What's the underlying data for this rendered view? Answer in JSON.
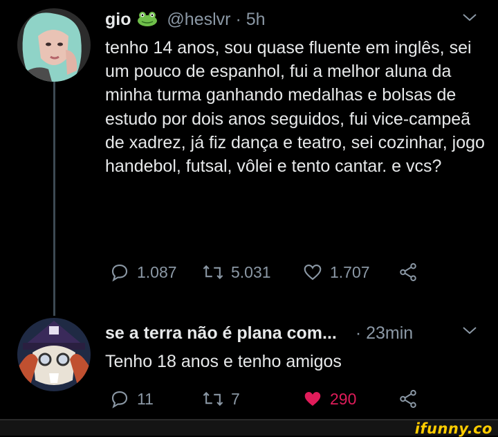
{
  "tweet1": {
    "display_name": "gio",
    "handle": "@heslvr",
    "separator": "·",
    "time": "5h",
    "text": "tenho 14 anos, sou quase fluente em inglês, sei um pouco de espanhol, fui a melhor aluna da minha turma ganhando medalhas e bolsas de estudo por dois anos seguidos, fui vice-campeã de xadrez, já fiz dança e teatro, sei cozinhar, jogo handebol, futsal, vôlei e tento cantar. e vcs?",
    "replies": "1.087",
    "retweets": "5.031",
    "likes": "1.707"
  },
  "tweet2": {
    "display_name": "se a terra não é plana com...",
    "separator": "·",
    "time": "23min",
    "text": "Tenho 18 anos e tenho amigos",
    "replies": "11",
    "retweets": "7",
    "likes": "290"
  },
  "watermark": "ifunny.co",
  "colors": {
    "background": "#000000",
    "muted": "#8b98a5",
    "like_active": "#e01c5a",
    "thread_line": "#3d4a53",
    "watermark": "#ffcc00"
  },
  "icons": [
    "frog-emoji-icon",
    "chevron-down-icon",
    "reply-icon",
    "retweet-icon",
    "heart-icon",
    "share-icon"
  ]
}
